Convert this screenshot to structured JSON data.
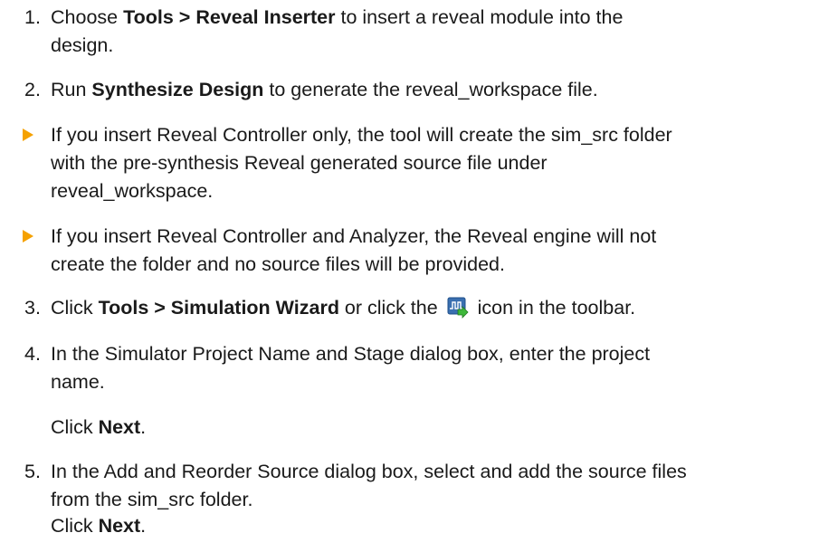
{
  "doc": {
    "steps": [
      {
        "num": "1.",
        "pre": "Choose ",
        "bold": "Tools > Reveal Inserter",
        "post_line1": " to insert a reveal module into the",
        "line2": "design."
      },
      {
        "num": "2.",
        "pre": "Run ",
        "bold": "Synthesize Design",
        "post": " to generate the reveal_workspace file."
      }
    ],
    "bullets": [
      {
        "lines": [
          "If you insert Reveal Controller only, the tool will create the sim_src folder",
          "with the pre-synthesis Reveal generated source file under",
          "reveal_workspace."
        ]
      },
      {
        "lines": [
          "If you insert Reveal Controller and Analyzer, the Reveal engine will not",
          "create the folder and no source files will be provided."
        ]
      }
    ],
    "step3": {
      "num": "3.",
      "pre": "Click ",
      "bold": "Tools > Simulation Wizard",
      "mid": " or click the ",
      "post": " icon in the toolbar.",
      "icon": "simulation-wizard-icon"
    },
    "step4": {
      "num": "4.",
      "line1": "In the Simulator Project Name and Stage dialog box, enter the project",
      "line2": "name.",
      "click_pre": "Click ",
      "click_bold": "Next",
      "click_post": "."
    },
    "step5": {
      "num": "5.",
      "line1": "In the Add and Reorder Source dialog box, select and add the source files",
      "line2": "from the sim_src folder.",
      "click_pre": "Click ",
      "click_bold": "Next",
      "click_post": "."
    },
    "colors": {
      "bullet": "#f5a100",
      "icon_bg": "#3a6fb0",
      "icon_arrow": "#3db83a"
    }
  }
}
